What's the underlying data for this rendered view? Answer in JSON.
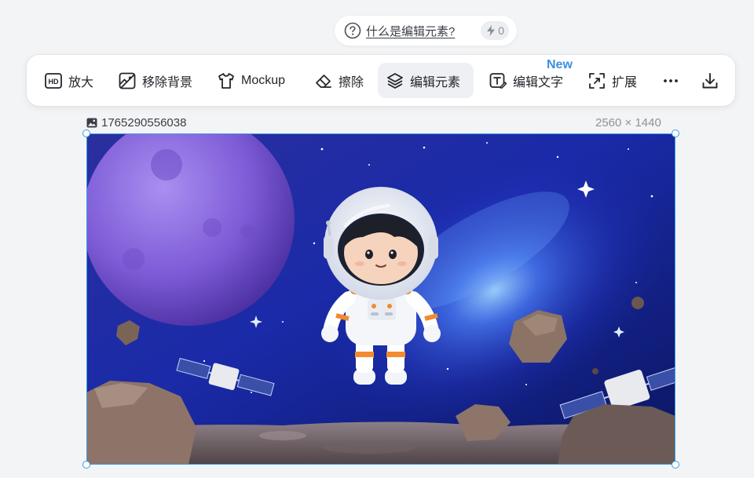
{
  "hint": {
    "text": "什么是编辑元素?",
    "credits": "0"
  },
  "toolbar": {
    "items": [
      {
        "label": "放大",
        "icon": "hd-icon"
      },
      {
        "label": "移除背景",
        "icon": "remove-background-icon"
      },
      {
        "label": "Mockup",
        "icon": "tshirt-icon"
      },
      {
        "label": "擦除",
        "icon": "eraser-icon"
      },
      {
        "label": "编辑元素",
        "icon": "layers-icon",
        "active": true
      },
      {
        "label": "编辑文字",
        "icon": "text-edit-icon",
        "badge": "New"
      },
      {
        "label": "扩展",
        "icon": "expand-icon"
      }
    ],
    "more_icon": "more-icon",
    "download_icon": "download-icon"
  },
  "image": {
    "name": "1765290556038",
    "dimensions": "2560 × 1440",
    "description_icon": "image-icon"
  },
  "colors": {
    "accent": "#3b9be8",
    "badge": "#3d8fe0",
    "active_bg": "#eef0f3"
  }
}
